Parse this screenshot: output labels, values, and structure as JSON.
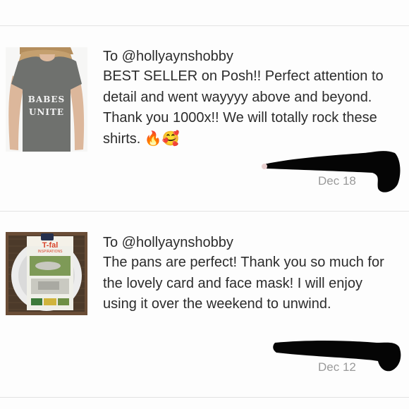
{
  "reviews": [
    {
      "to": "To @hollyaynshobby",
      "message": "BEST SELLER on Posh!! Perfect attention to detail and went wayyyy above and beyond. Thank you 1000x!! We will totally rock these shirts. 🔥🥰",
      "date": "Dec 18",
      "thumbnail": {
        "shirt_text_line1": "BABES",
        "shirt_text_line2": "UNITE",
        "shirt_color": "#6f716e"
      }
    },
    {
      "to": "To @hollyaynshobby",
      "message": "The pans are perfect! Thank you so much for the lovely card and face mask! I will enjoy using it over the weekend to unwind.",
      "date": "Dec 12",
      "thumbnail": {
        "brand": "T-fal",
        "sub_brand": "INSPIRATIONS"
      }
    }
  ],
  "colors": {
    "text": "#2c2c2c",
    "date": "#9a9a9a",
    "divider": "#e3e3e3",
    "redaction": "#050505"
  }
}
